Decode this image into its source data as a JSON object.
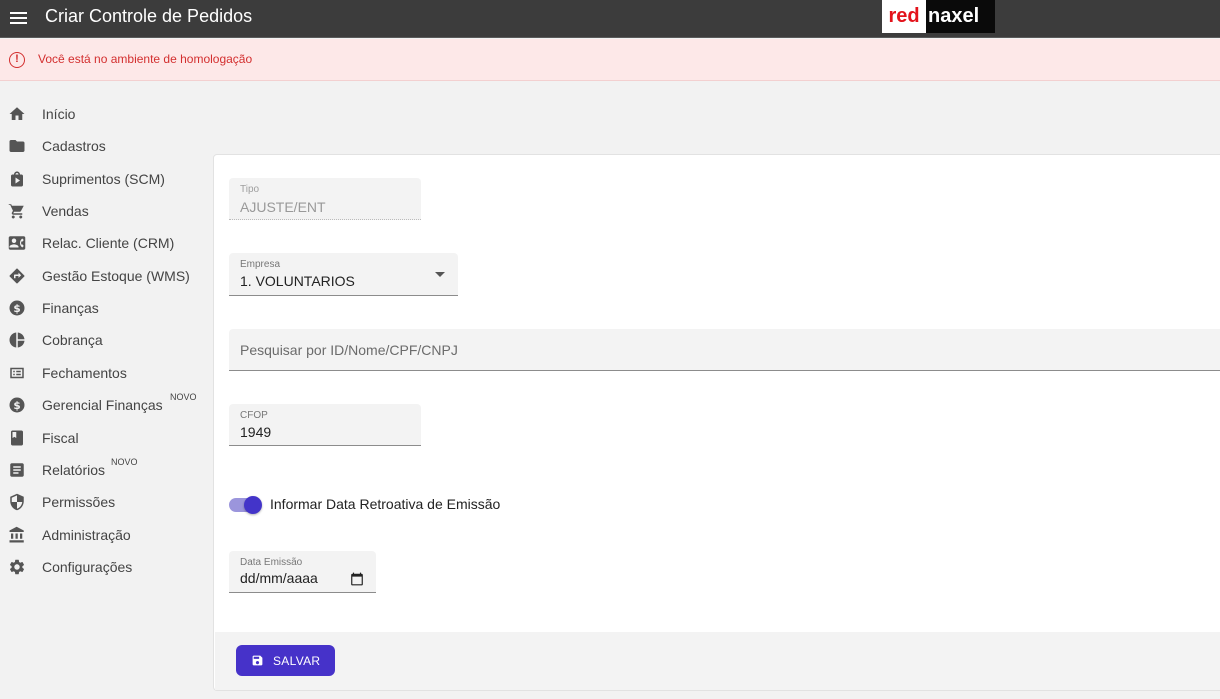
{
  "header": {
    "title": "Criar Controle de Pedidos",
    "logo_left": "red",
    "logo_right": "naxel",
    "logo_colors": {
      "left_bg": "#ffffff",
      "left_text": "#e3131b",
      "right_bg": "#0a0a0a",
      "right_text": "#ffffff"
    },
    "bar_color": "#3c3c3c"
  },
  "alert": {
    "icon": "!",
    "text": "Você está no ambiente de homologação",
    "color": "#d32f2f",
    "background": "#fde8e8"
  },
  "sidebar": {
    "items": [
      {
        "label": "Início",
        "icon": "home-icon"
      },
      {
        "label": "Cadastros",
        "icon": "folder-icon"
      },
      {
        "label": "Suprimentos (SCM)",
        "icon": "shopping-bag-icon"
      },
      {
        "label": "Vendas",
        "icon": "cart-icon"
      },
      {
        "label": "Relac. Cliente (CRM)",
        "icon": "contact-card-icon"
      },
      {
        "label": "Gestão Estoque (WMS)",
        "icon": "directions-icon"
      },
      {
        "label": "Finanças",
        "icon": "dollar-icon"
      },
      {
        "label": "Cobrança",
        "icon": "pie-chart-icon"
      },
      {
        "label": "Fechamentos",
        "icon": "list-window-icon"
      },
      {
        "label": "Gerencial Finanças",
        "icon": "dollar-icon",
        "badge": "NOVO"
      },
      {
        "label": "Fiscal",
        "icon": "book-icon"
      },
      {
        "label": "Relatórios",
        "icon": "report-icon",
        "badge": "NOVO"
      },
      {
        "label": "Permissões",
        "icon": "shield-icon"
      },
      {
        "label": "Administração",
        "icon": "bank-icon"
      },
      {
        "label": "Configurações",
        "icon": "gear-icon"
      }
    ]
  },
  "form": {
    "tipo": {
      "label": "Tipo",
      "value": "AJUSTE/ENT"
    },
    "empresa": {
      "label": "Empresa",
      "value": "1. VOLUNTARIOS"
    },
    "search": {
      "placeholder": "Pesquisar por ID/Nome/CPF/CNPJ"
    },
    "cfop": {
      "label": "CFOP",
      "value": "1949"
    },
    "toggle": {
      "label": "Informar Data Retroativa de Emissão",
      "on": true
    },
    "data_emissao": {
      "label": "Data Emissão",
      "value": "dd/mm/aaaa"
    },
    "save_button": {
      "label": "SALVAR",
      "icon": "save-icon",
      "color": "#4632c9"
    }
  }
}
